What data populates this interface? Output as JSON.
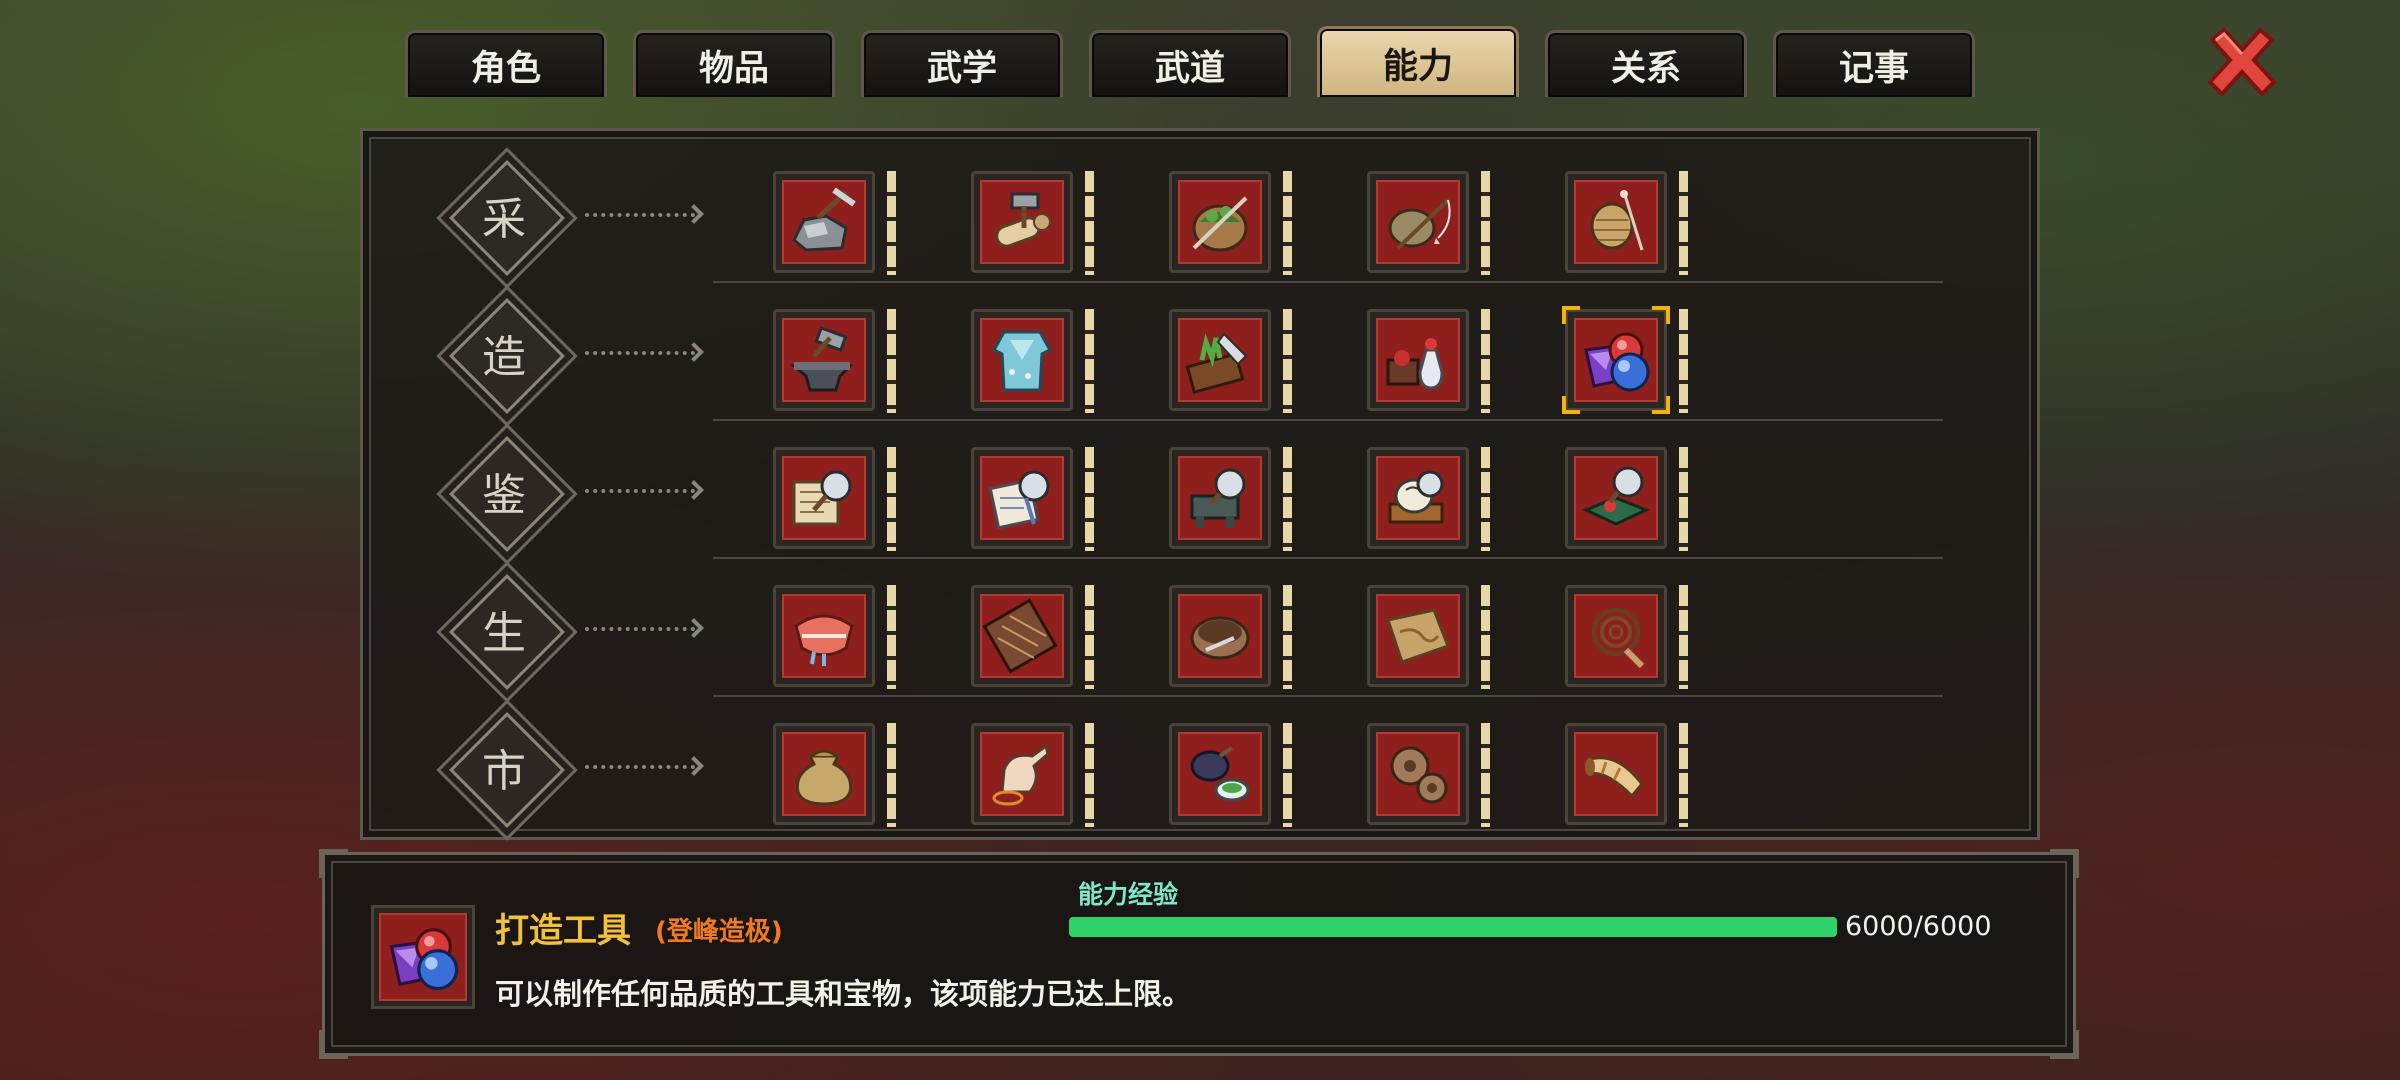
{
  "tabs": [
    {
      "label": "角色",
      "active": false
    },
    {
      "label": "物品",
      "active": false
    },
    {
      "label": "武学",
      "active": false
    },
    {
      "label": "武道",
      "active": false
    },
    {
      "label": "能力",
      "active": true
    },
    {
      "label": "关系",
      "active": false
    },
    {
      "label": "记事",
      "active": false
    }
  ],
  "close_icon": "close-x-icon",
  "categories": [
    {
      "char": "采",
      "skills": [
        "mining-icon",
        "logging-icon",
        "herb-gathering-icon",
        "fishing-icon",
        "weaving-harvest-icon"
      ]
    },
    {
      "char": "造",
      "skills": [
        "forging-icon",
        "tailoring-icon",
        "cooking-icon",
        "alchemy-icon",
        "toolmaking-icon"
      ]
    },
    {
      "char": "鉴",
      "skills": [
        "appraise-scroll-icon",
        "appraise-book-icon",
        "appraise-weapon-icon",
        "appraise-antique-icon",
        "appraise-treasure-icon"
      ]
    },
    {
      "char": "生",
      "skills": [
        "medicine-icon",
        "chess-board-icon",
        "bowl-icon",
        "map-icon",
        "whip-icon"
      ]
    },
    {
      "char": "市",
      "skills": [
        "money-bag-icon",
        "bargain-hand-icon",
        "tea-icon",
        "gears-icon",
        "horn-icon"
      ]
    }
  ],
  "selected": {
    "row": 1,
    "col": 4
  },
  "detail": {
    "name": "打造工具",
    "rank": "(登峰造极)",
    "description": "可以制作任何品质的工具和宝物，该项能力已达上限。",
    "exp_label": "能力经验",
    "exp_current": 6000,
    "exp_max": 6000,
    "exp_text": "6000/6000"
  },
  "colors": {
    "slot_red": "#8e1f1d",
    "exp_green": "#2fd16b",
    "name_gold": "#f1c13a",
    "rank_orange": "#f07a23",
    "selected_frame": "#f5b400"
  }
}
